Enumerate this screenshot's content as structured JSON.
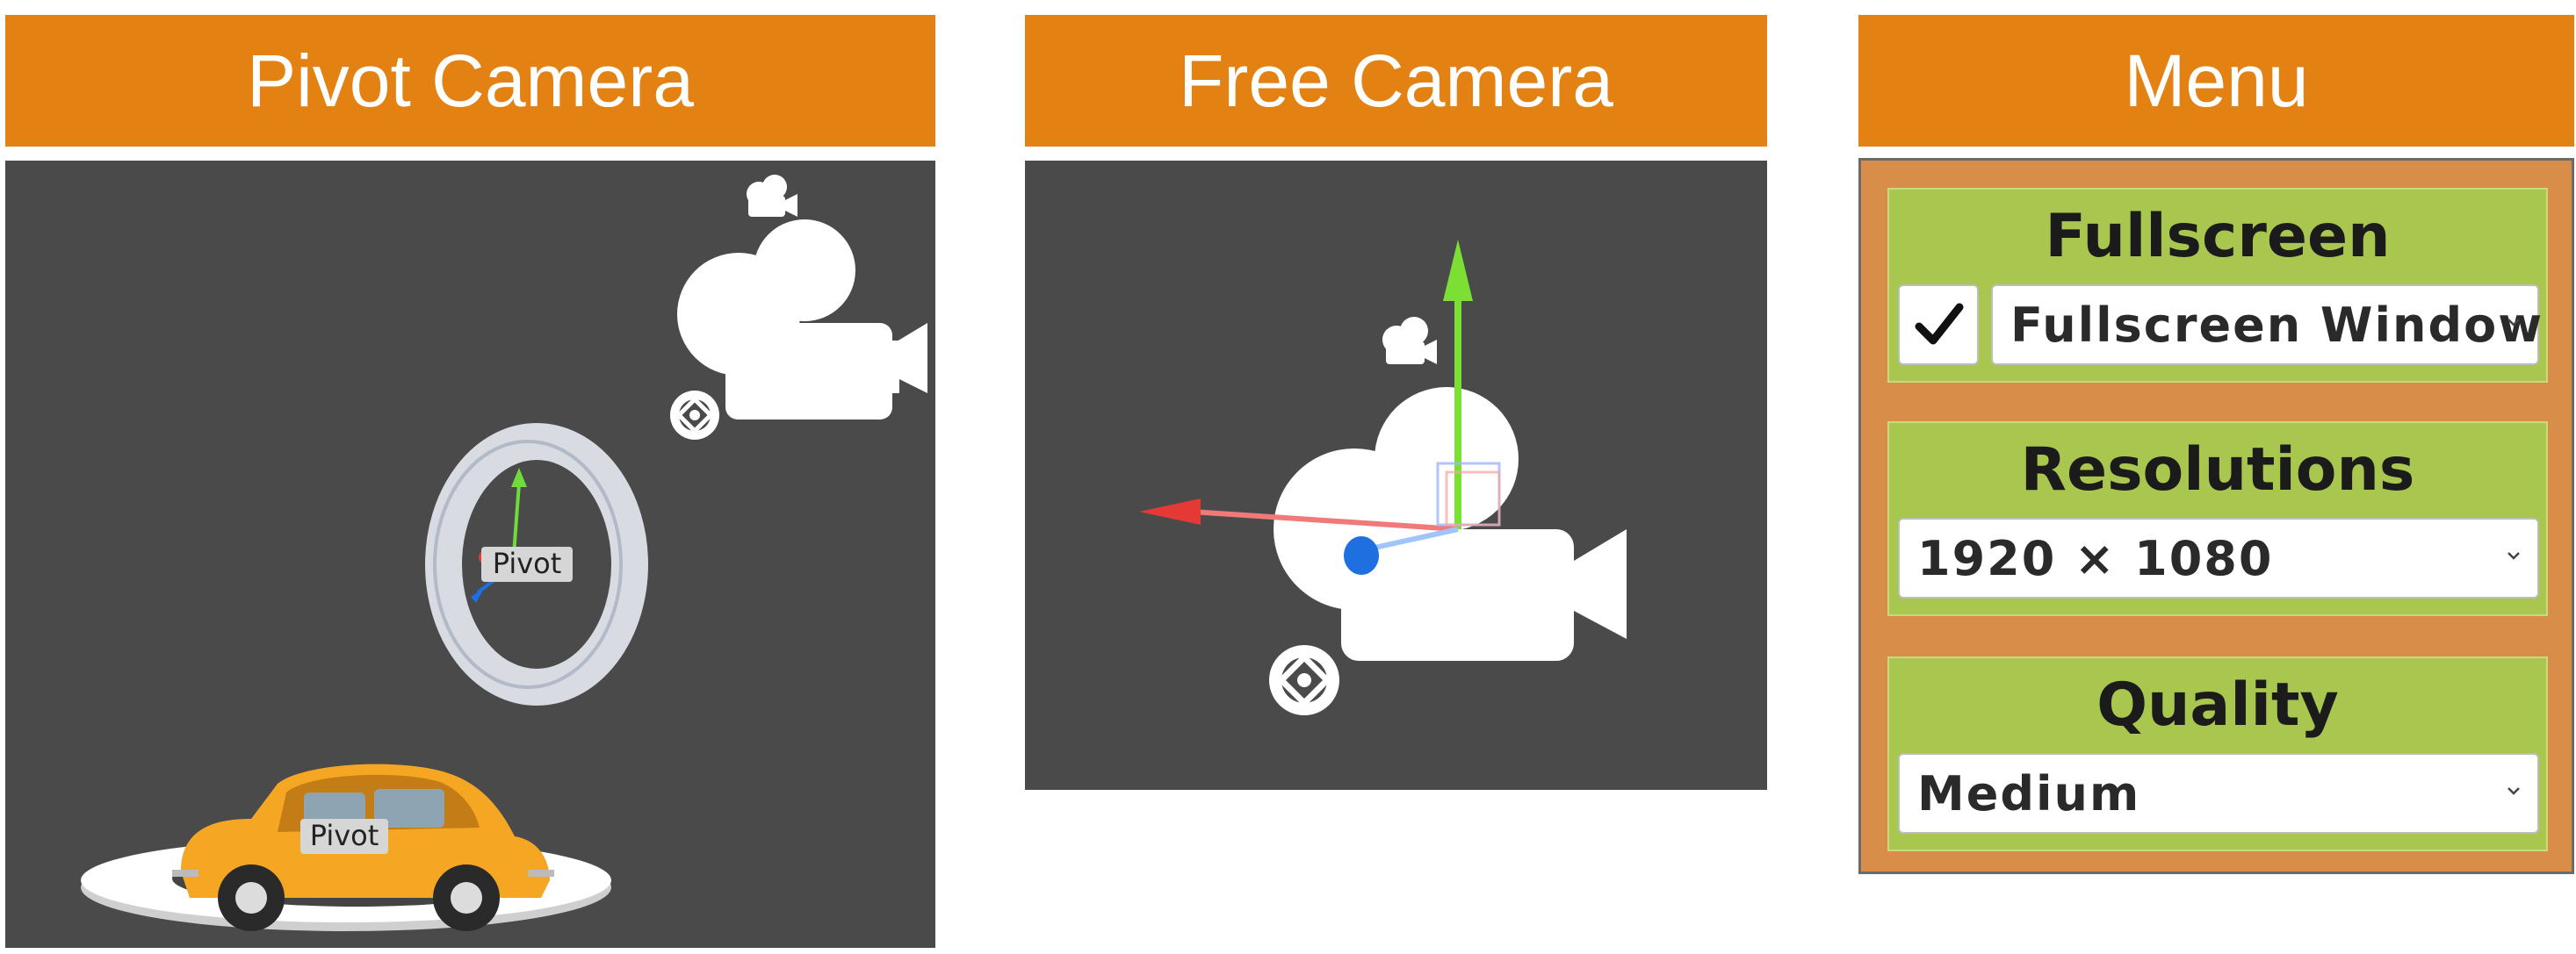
{
  "panels": [
    {
      "title": "Pivot Camera"
    },
    {
      "title": "Free Camera"
    },
    {
      "title": "Menu"
    }
  ],
  "pivot_viewport": {
    "labels": {
      "ring_label": "Pivot",
      "car_label": "Pivot"
    }
  },
  "menu": {
    "fullscreen": {
      "title": "Fullscreen",
      "checked": true,
      "value": "Fullscreen Window"
    },
    "resolutions": {
      "title": "Resolutions",
      "value": "1920 × 1080"
    },
    "quality": {
      "title": "Quality",
      "value": "Medium"
    }
  },
  "colors": {
    "header_orange": "#E38212",
    "viewport_gray": "#4a4a4a",
    "menu_frame": "#D88D49",
    "menu_card_green": "#A9C64E",
    "car_yellow": "#F5A623"
  },
  "icons": [
    "camera-icon",
    "aperture-icon",
    "checkmark-icon",
    "chevron-down-icon",
    "move-gizmo-icon"
  ]
}
